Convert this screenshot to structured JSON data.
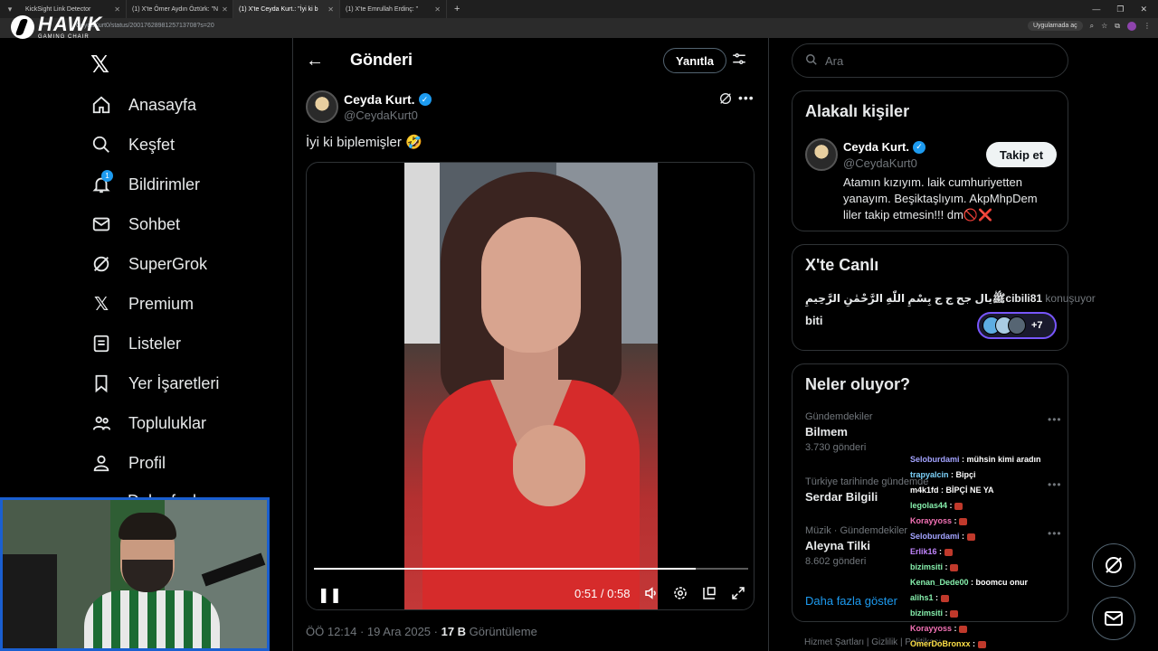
{
  "browser": {
    "tabs": [
      {
        "label": "KickSight Link Detector",
        "active": false
      },
      {
        "label": "(1) X'te Ömer Aydın Öztürk: \"N",
        "active": false
      },
      {
        "label": "(1) X'te Ceyda Kurt.: \"İyi ki b",
        "active": true
      },
      {
        "label": "(1) X'te Emrullah Erdinç: \"",
        "active": false
      }
    ],
    "url": "/CeydaKurt0/status/2001762898125713708?s=20",
    "app_button": "Uygulamada aç"
  },
  "overlay": {
    "brand": "HAWK",
    "brand_sub": "GAMING CHAIR"
  },
  "nav": {
    "items": [
      {
        "label": "Anasayfa",
        "icon": "home-icon"
      },
      {
        "label": "Keşfet",
        "icon": "search-icon"
      },
      {
        "label": "Bildirimler",
        "icon": "bell-icon",
        "badge": "1"
      },
      {
        "label": "Sohbet",
        "icon": "mail-icon"
      },
      {
        "label": "SuperGrok",
        "icon": "grok-icon"
      },
      {
        "label": "Premium",
        "icon": "x-icon"
      },
      {
        "label": "Listeler",
        "icon": "list-icon"
      },
      {
        "label": "Yer İşaretleri",
        "icon": "bookmark-icon"
      },
      {
        "label": "Topluluklar",
        "icon": "communities-icon"
      },
      {
        "label": "Profil",
        "icon": "profile-icon"
      }
    ],
    "more_label": "Daha fazla"
  },
  "header": {
    "title": "Gönderi",
    "reply_label": "Yanıtla"
  },
  "post": {
    "author_name": "Ceyda Kurt.",
    "author_handle": "@CeydaKurt0",
    "text": "İyi ki biplemişler 🤣",
    "video": {
      "time": "0:51 / 0:58",
      "progress": 0.88
    },
    "timestamp": "ÖÖ 12:14 · 19 Ara 2025 · ",
    "views_count": "17 B",
    "views_label": " Görüntüleme"
  },
  "search": {
    "placeholder": "Ara"
  },
  "related": {
    "title": "Alakalı kişiler",
    "name": "Ceyda Kurt.",
    "handle": "@CeydaKurt0",
    "follow_label": "Takip et",
    "bio": "Atamın kızıyım. laik cumhuriyetten yanayım. Beşiktaşlıyım. AkpMhpDem liler takip etmesin!!! dm🚫❌"
  },
  "live": {
    "title": "X'te Canlı",
    "host": "ﷺيال جح ج ج بِسْمِ اللّٰهِ الرَّحْمٰنِ الرَّحِيمِcibili81",
    "speaking": " konuşuyor",
    "topic": "biti",
    "more_count": "+7"
  },
  "trends": {
    "title": "Neler oluyor?",
    "items": [
      {
        "context": "Gündemdekiler",
        "name": "Bilmem",
        "count": "3.730 gönderi"
      },
      {
        "context": "Türkiye tarihinde gündemde",
        "name": "Serdar Bilgili",
        "count": ""
      },
      {
        "context": "Müzik · Gündemdekiler",
        "name": "Aleyna Tilki",
        "count": "8.602 gönderi"
      }
    ],
    "show_more": "Daha fazla göster"
  },
  "footer": {
    "links": "Hizmet Şartları   |   Gizlilik   |   Politikası"
  },
  "chat": {
    "messages": [
      {
        "user": "Seloburdami",
        "color": "#a3a3ff",
        "text": "mühsin kimi aradın"
      },
      {
        "user": "trapyalcin",
        "color": "#7dd3fc",
        "text": "Bipçi"
      },
      {
        "user": "m4k1fd",
        "color": "#ffffff",
        "text": "BİPÇİ NE YA"
      },
      {
        "user": "legolas44",
        "color": "#86efac",
        "text": ""
      },
      {
        "user": "Korayyoss",
        "color": "#f472b6",
        "text": ""
      },
      {
        "user": "Seloburdami",
        "color": "#a3a3ff",
        "text": ""
      },
      {
        "user": "Erlik16",
        "color": "#c084fc",
        "text": ""
      },
      {
        "user": "bizimsiti",
        "color": "#86efac",
        "text": ""
      },
      {
        "user": "Kenan_Dede00",
        "color": "#86efac",
        "text": "boomcu onur"
      },
      {
        "user": "alihs1",
        "color": "#86efac",
        "text": ""
      },
      {
        "user": "bizimsiti",
        "color": "#86efac",
        "text": ""
      },
      {
        "user": "Korayyoss",
        "color": "#f472b6",
        "text": ""
      },
      {
        "user": "OmerDoBronxx",
        "color": "#fde047",
        "text": ""
      }
    ]
  },
  "colors": {
    "accent": "#1d9bf0",
    "background": "#000000",
    "border": "#2f3336",
    "muted": "#71767b",
    "webcam_border": "#1a5fd0"
  }
}
